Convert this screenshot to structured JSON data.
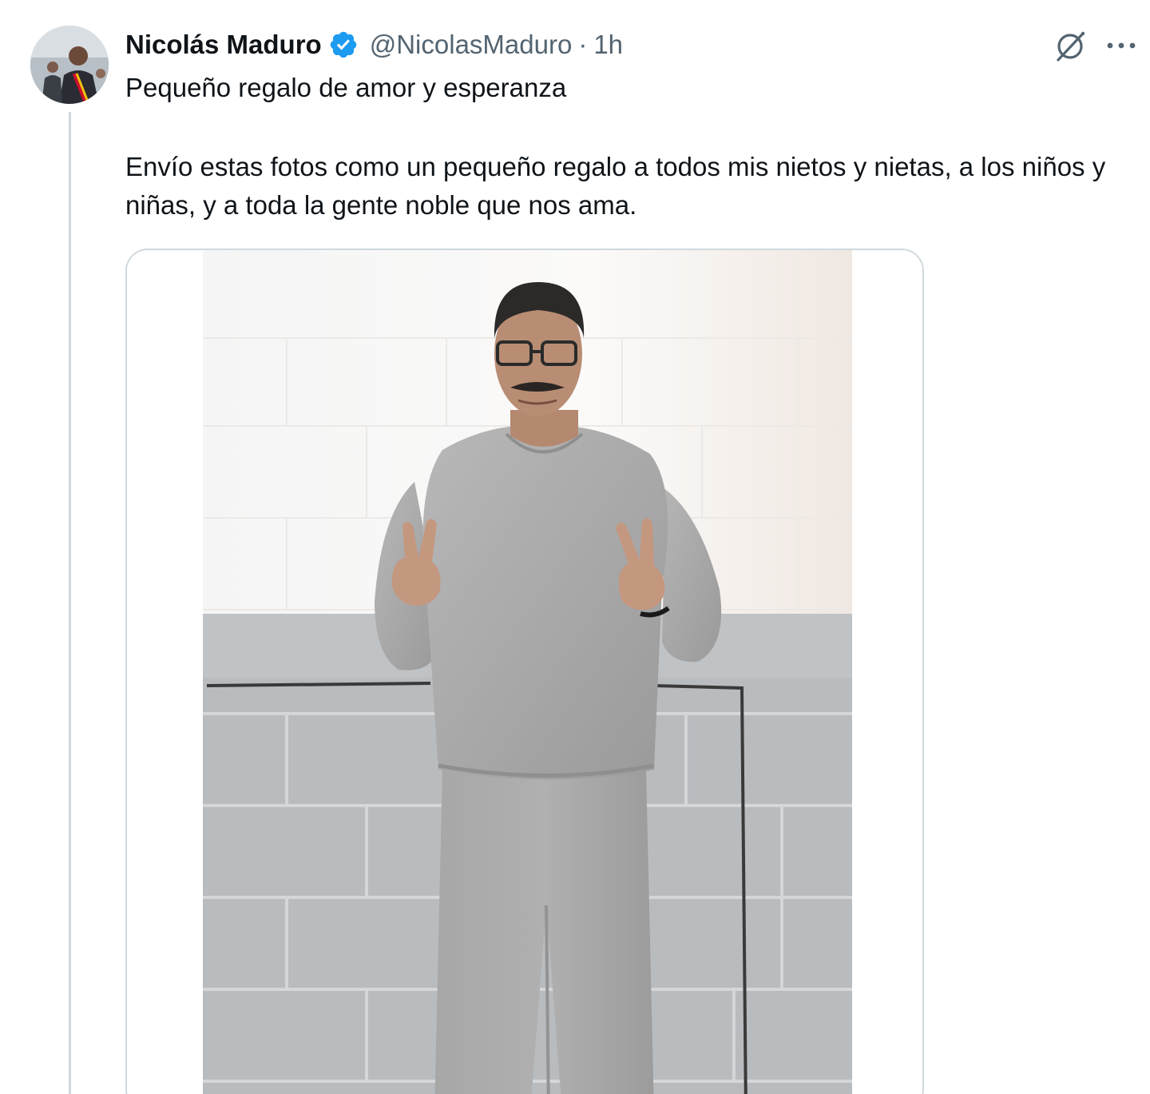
{
  "author": {
    "display_name": "Nicolás Maduro",
    "handle": "@NicolasMaduro",
    "separator": "·",
    "time": "1h",
    "verified": true,
    "verified_color": "#1d9bf0"
  },
  "tweet": {
    "title": "Pequeño regalo de amor y esperanza",
    "body": "Envío estas fotos como un pequeño regalo a todos mis nietos y nietas, a los niños y niñas, y a toda la gente noble que nos ama."
  },
  "icons": {
    "avatar": "profile-avatar",
    "verified": "verified-badge-icon",
    "grok": "grok-icon",
    "more": "more-options-icon"
  },
  "colors": {
    "text_primary": "#0f1419",
    "text_secondary": "#536471",
    "border": "#cfd9de"
  }
}
